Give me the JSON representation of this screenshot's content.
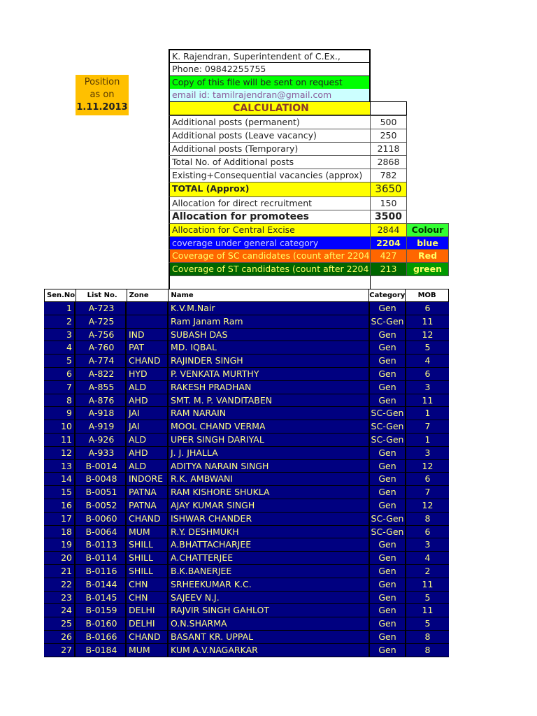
{
  "position_note": {
    "line1": "Position",
    "line2": "as on",
    "date": "1.11.2013"
  },
  "header": {
    "author": "K. Rajendran, Superintendent of C.Ex.,",
    "phone": "Phone: 09842255755",
    "copy_note": "Copy of this file will be sent on request",
    "email": "email id: tamilrajendran@gmail.com",
    "calc_title": "CALCULATION"
  },
  "calc": [
    {
      "label": "Additional posts (permanent)",
      "value": "500"
    },
    {
      "label": "Additional posts (Leave vacancy)",
      "value": "250"
    },
    {
      "label": "Additional posts (Temporary)",
      "value": "2118"
    },
    {
      "label": "Total No. of Additional posts",
      "value": "2868"
    },
    {
      "label": "Existing+Consequential vacancies (approx)",
      "value": "782"
    },
    {
      "label": "TOTAL (Approx)",
      "value": "3650"
    },
    {
      "label": "Allocation for direct recruitment",
      "value": "150"
    },
    {
      "label": "Allocation for promotees",
      "value": "3500"
    },
    {
      "label": "Allocation for Central Excise",
      "value": "2844",
      "colour": "Colour"
    },
    {
      "label": "coverage under general category",
      "value": "2204",
      "colour": "blue"
    },
    {
      "label": "Coverage of SC candidates (count after 2204",
      "value": "427",
      "colour": "Red"
    },
    {
      "label": "Coverage of ST candidates (count after 2204",
      "value": "213",
      "colour": "green"
    }
  ],
  "table": {
    "headers": [
      "Sen.No",
      "List No.",
      "Zone",
      "Name",
      "Category",
      "MOB"
    ],
    "rows": [
      [
        "1",
        "A-723",
        "",
        "K.V.M.Nair",
        "Gen",
        "6"
      ],
      [
        "2",
        "A-725",
        "",
        "Ram Janam Ram",
        "SC-Gen",
        "11"
      ],
      [
        "3",
        "A-756",
        "IND",
        "SUBASH  DAS",
        "Gen",
        "12"
      ],
      [
        "4",
        "A-760",
        "PAT",
        "MD. IQBAL",
        "Gen",
        "5"
      ],
      [
        "5",
        "A-774",
        "CHAND",
        "RAJINDER  SINGH",
        "Gen",
        "4"
      ],
      [
        "6",
        "A-822",
        "HYD",
        "P.  VENKATA  MURTHY",
        "Gen",
        "6"
      ],
      [
        "7",
        "A-855",
        "ALD",
        "RAKESH  PRADHAN",
        "Gen",
        "3"
      ],
      [
        "8",
        "A-876",
        "AHD",
        "SMT.  M. P.  VANDITABEN",
        "Gen",
        "11"
      ],
      [
        "9",
        "A-918",
        "JAI",
        "RAM  NARAIN",
        "SC-Gen",
        "1"
      ],
      [
        "10",
        "A-919",
        "JAI",
        "MOOL CHAND  VERMA",
        "SC-Gen",
        "7"
      ],
      [
        "11",
        "A-926",
        "ALD",
        "UPER  SINGH DARIYAL",
        "SC-Gen",
        "1"
      ],
      [
        "12",
        "A-933",
        "AHD",
        "J.  J. JHALLA",
        "Gen",
        "3"
      ],
      [
        "13",
        "B-0014",
        "ALD",
        "ADITYA NARAIN SINGH",
        "Gen",
        "12"
      ],
      [
        "14",
        "B-0048",
        "INDORE",
        "R.K. AMBWANI",
        "Gen",
        "6"
      ],
      [
        "15",
        "B-0051",
        "PATNA",
        "RAM KISHORE SHUKLA",
        "Gen",
        "7"
      ],
      [
        "16",
        "B-0052",
        "PATNA",
        "AJAY KUMAR SINGH",
        "Gen",
        "12"
      ],
      [
        "17",
        "B-0060",
        "CHAND",
        "ISHWAR CHANDER",
        "SC-Gen",
        "8"
      ],
      [
        "18",
        "B-0064",
        "MUM",
        "R.Y. DESHMUKH",
        "SC-Gen",
        "6"
      ],
      [
        "19",
        "B-0113",
        "SHILL",
        "A.BHATTACHARJEE",
        "Gen",
        "3"
      ],
      [
        "20",
        "B-0114",
        "SHILL",
        "A.CHATTERJEE",
        "Gen",
        "4"
      ],
      [
        "21",
        "B-0116",
        "SHILL",
        "B.K.BANERJEE",
        "Gen",
        "2"
      ],
      [
        "22",
        "B-0144",
        "CHN",
        "SRHEEKUMAR K.C.",
        "Gen",
        "11"
      ],
      [
        "23",
        "B-0145",
        "CHN",
        "SAJEEV N.J.",
        "Gen",
        "5"
      ],
      [
        "24",
        "B-0159",
        "DELHI",
        "RAJVIR SINGH GAHLOT",
        "Gen",
        "11"
      ],
      [
        "25",
        "B-0160",
        "DELHI",
        "O.N.SHARMA",
        "Gen",
        "5"
      ],
      [
        "26",
        "B-0166",
        "CHAND",
        "BASANT KR. UPPAL",
        "Gen",
        "8"
      ],
      [
        "27",
        "B-0184",
        "MUM",
        "KUM A.V.NAGARKAR",
        "Gen",
        "8"
      ]
    ]
  }
}
